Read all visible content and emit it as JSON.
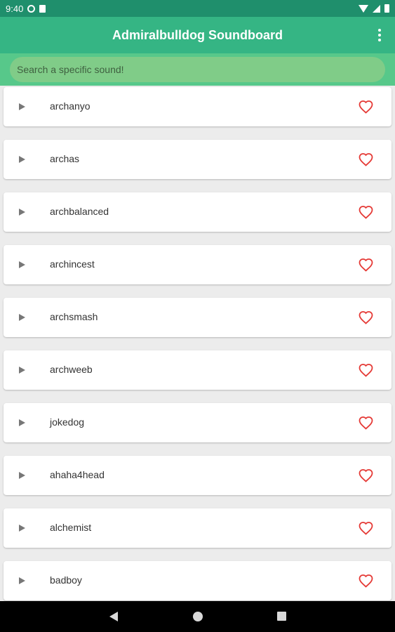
{
  "status_bar": {
    "time": "9:40",
    "icons": [
      "data-saver-icon",
      "sd-card-icon",
      "wifi-icon",
      "signal-icon",
      "battery-icon"
    ]
  },
  "app_bar": {
    "title": "Admiralbulldog Soundboard",
    "menu_icon": "more-vert-icon"
  },
  "search": {
    "placeholder": "Search a specific sound!",
    "value": ""
  },
  "sounds": [
    {
      "label": "archanyo"
    },
    {
      "label": "archas"
    },
    {
      "label": "archbalanced"
    },
    {
      "label": "archincest"
    },
    {
      "label": "archsmash"
    },
    {
      "label": "archweeb"
    },
    {
      "label": "jokedog"
    },
    {
      "label": "ahaha4head"
    },
    {
      "label": "alchemist"
    },
    {
      "label": "badboy"
    }
  ],
  "item_icons": {
    "play": "play-icon",
    "favorite": "heart-outline-icon"
  },
  "nav_bar": {
    "icons": [
      "back-icon",
      "home-icon",
      "recents-icon"
    ]
  },
  "colors": {
    "status_bar": "#1f8f6c",
    "app_bar": "#35b584",
    "search_band": "#57c88a",
    "search_field": "#80cc88",
    "heart": "#e53935",
    "play": "#777777",
    "list_background": "#ececec"
  }
}
